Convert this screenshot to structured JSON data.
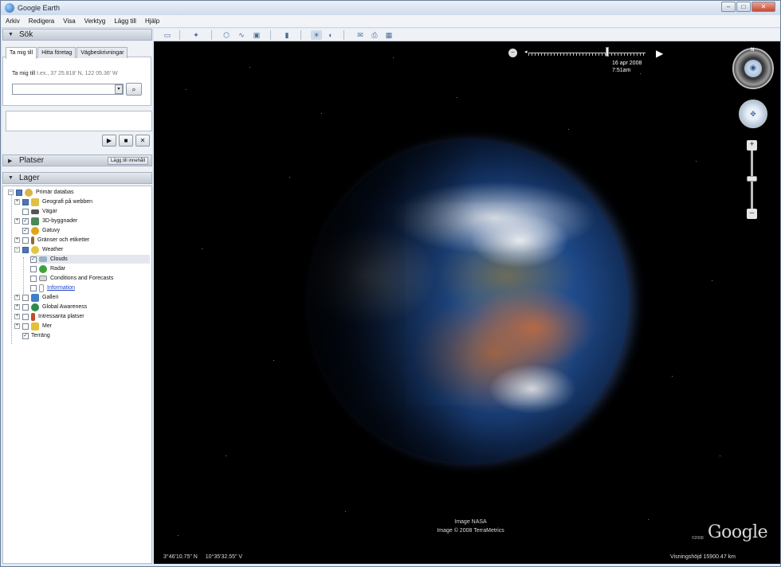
{
  "window": {
    "title": "Google Earth",
    "buttons": {
      "minimize": "–",
      "maximize": "□",
      "close": "✕"
    }
  },
  "menu": [
    "Arkiv",
    "Redigera",
    "Visa",
    "Verktyg",
    "Lägg till",
    "Hjälp"
  ],
  "search_panel": {
    "header": "Sök",
    "tabs": [
      "Ta mig till",
      "Hitta företag",
      "Vägbeskrivningar"
    ],
    "goto_label": "Ta mig till",
    "goto_hint": "t.ex., 37 25.818' N, 122 05.36' W",
    "input_value": "",
    "dropdown_icon": "▾",
    "search_icon": "magnifier-icon",
    "playback": {
      "play": "▶",
      "stop": "■",
      "close": "✕"
    }
  },
  "places_panel": {
    "header": "Platser",
    "add_content_button": "Lägg till innehåll"
  },
  "layers_panel": {
    "header": "Lager",
    "items": [
      {
        "label": "Primär databas",
        "checked": "partial",
        "icon_color": "#d9b44a"
      },
      {
        "label": "Geografi på webben",
        "checked": "partial",
        "icon_color": "#e0c040"
      },
      {
        "label": "Vägar",
        "checked": "none",
        "icon_color": "#555555"
      },
      {
        "label": "3D-byggnader",
        "checked": "checked",
        "icon_color": "#4a8a5a"
      },
      {
        "label": "Gatuvy",
        "checked": "checked",
        "icon_color": "#e3a21a"
      },
      {
        "label": "Gränser och etiketter",
        "checked": "none",
        "icon_color": "#8a6d3a"
      },
      {
        "label": "Weather",
        "checked": "partial",
        "icon_color": "#e6c43b"
      },
      {
        "label": "Clouds",
        "checked": "checked",
        "icon_color": "#9bb1c8"
      },
      {
        "label": "Radar",
        "checked": "none",
        "icon_color": "#3aa33a"
      },
      {
        "label": "Conditions and Forecasts",
        "checked": "none",
        "icon_color": "#d8d8d8"
      },
      {
        "label": "Information",
        "checked": "none",
        "icon_color": "#cccccc"
      },
      {
        "label": "Galleri",
        "checked": "none",
        "icon_color": "#3f7fc8"
      },
      {
        "label": "Global Awareness",
        "checked": "none",
        "icon_color": "#2d8a4a"
      },
      {
        "label": "Intressanta platser",
        "checked": "none",
        "icon_color": "#c44a2a"
      },
      {
        "label": "Mer",
        "checked": "none",
        "icon_color": "#e2c03a"
      },
      {
        "label": "Terräng",
        "checked": "checked",
        "icon_color": "#ffffff"
      }
    ]
  },
  "toolbar": {
    "icons": [
      "sidebar-toggle-icon",
      "placemark-icon",
      "polygon-icon",
      "path-icon",
      "overlay-icon",
      "ruler-icon",
      "sun-icon",
      "planet-icon",
      "email-icon",
      "print-icon",
      "maps-icon"
    ],
    "glyphs": [
      "▭",
      "✦",
      "⬡",
      "∿",
      "▣",
      "▮",
      "☀",
      "◐",
      "✉",
      "⎙",
      "▦"
    ]
  },
  "viewport": {
    "time_slider": {
      "left_glyph": "◂",
      "right_glyph": "▶",
      "reset_glyph": "–",
      "date": "16 apr 2008",
      "time": "7:51am"
    },
    "compass_north": "N",
    "look_glyph": "◉",
    "move_glyph": "✥",
    "zoom_plus": "+",
    "zoom_minus": "–",
    "credits": [
      "Image NASA",
      "Image © 2008 TerraMetrics"
    ],
    "logo_text": "Google",
    "logo_year": "©2008",
    "coords": {
      "lat": "3°46'10.75\" N",
      "lon": "10°35'32.55\" V"
    },
    "eye_altitude": "Visningshöjd 15900.47 km"
  }
}
